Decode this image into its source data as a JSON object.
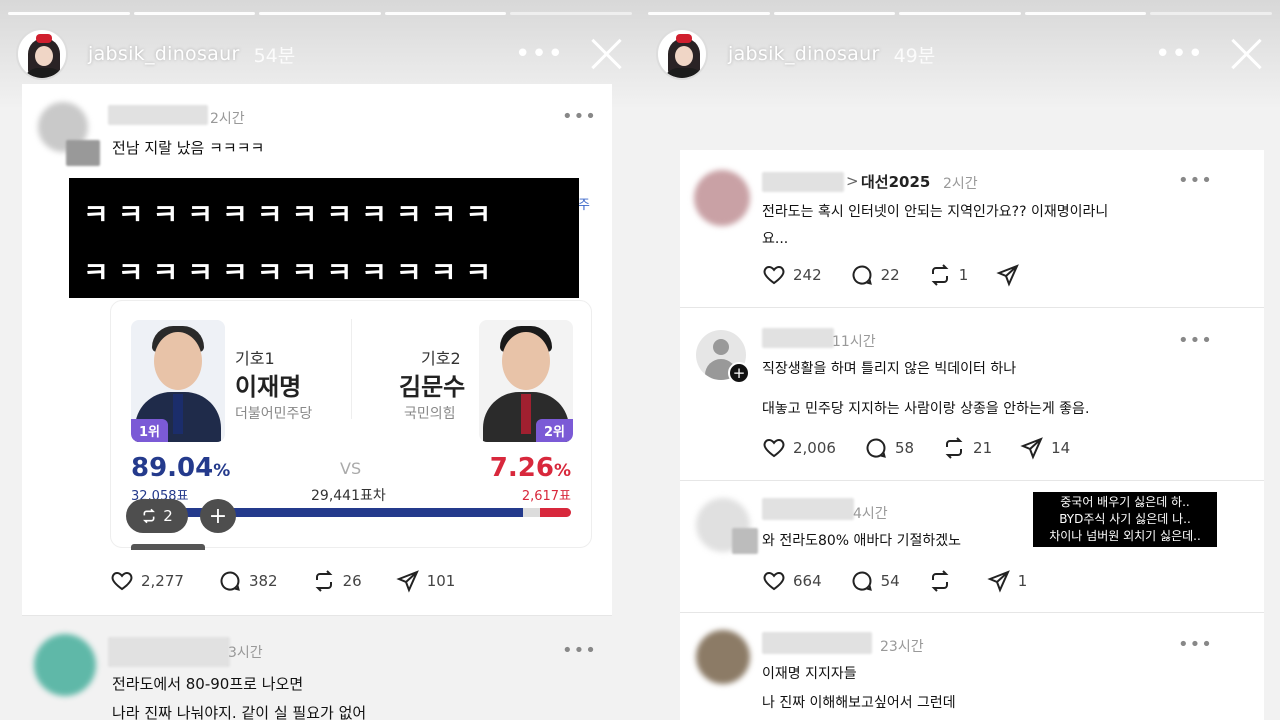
{
  "left_story": {
    "header": {
      "username": "jabsik_dinosaur",
      "age": "54분",
      "more": "•••"
    },
    "post1": {
      "time": "2시간",
      "text": "전남 지랄 났음 ㅋㅋㅋㅋ",
      "censor_line1": "ㅋㅋㅋㅋㅋㅋㅋㅋㅋㅋㅋㅋ",
      "censor_line2": "ㅋㅋㅋㅋㅋㅋㅋㅋㅋㅋㅋㅋ",
      "edge_char": "주",
      "election": {
        "candidate1": {
          "number": "기호1",
          "name": "이재명",
          "party": "더불어민주당",
          "rank": "1위",
          "pct": "89.04",
          "pct_unit": "%",
          "votes": "32,058표"
        },
        "candidate2": {
          "number": "기호2",
          "name": "김문수",
          "party": "국민의힘",
          "rank": "2위",
          "pct": "7.26",
          "pct_unit": "%",
          "votes": "2,617표"
        },
        "vs": "VS",
        "difference": "29,441표차",
        "share_candidate1": 0.89,
        "share_candidate2": 0.07
      },
      "repost_pill": "2",
      "plus": "+",
      "likes": "2,277",
      "comments": "382",
      "reposts": "26",
      "shares": "101"
    },
    "post2": {
      "time": "3시간",
      "line1": "전라도에서 80-90프로 나오면",
      "line2": "나라 진짜 나눠야지. 같이 실 필요가 없어"
    },
    "colors": {
      "blue": "#243a8c",
      "red": "#d8283c",
      "rank1": "#7b5ad6",
      "rank2": "#7b5ad6"
    }
  },
  "right_story": {
    "header": {
      "username": "jabsik_dinosaur",
      "age": "49분",
      "more": "•••"
    },
    "post1": {
      "topic_prefix": ">",
      "topic": "대선2025",
      "time": "2시간",
      "line1": "전라도는 혹시 인터넷이 안되는 지역인가요?? 이재명이라니",
      "line2": "요...",
      "likes": "242",
      "comments": "22",
      "reposts": "1"
    },
    "post2": {
      "time": "11시간",
      "line1": "직장생활을 하며 틀리지 않은 빅데이터 하나",
      "line2": "대놓고 민주당 지지하는 사람이랑 상종을 안하는게 좋음.",
      "likes": "2,006",
      "comments": "58",
      "reposts": "21",
      "shares": "14"
    },
    "post3": {
      "time": "4시간",
      "text": "와 전라도80% 애바다 기절하겠노",
      "likes": "664",
      "comments": "54",
      "shares": "1"
    },
    "post4": {
      "time": "23시간",
      "line1": "이재명 지지자들",
      "line2": "나 진짜 이해해보고싶어서 그런데"
    },
    "overlay": {
      "line1": "중국어 배우기 싫은데 하..",
      "line2": "BYD주식 사기 싫은데 나..",
      "line3": "차이나 넘버원 외치기 싫은데.."
    }
  }
}
